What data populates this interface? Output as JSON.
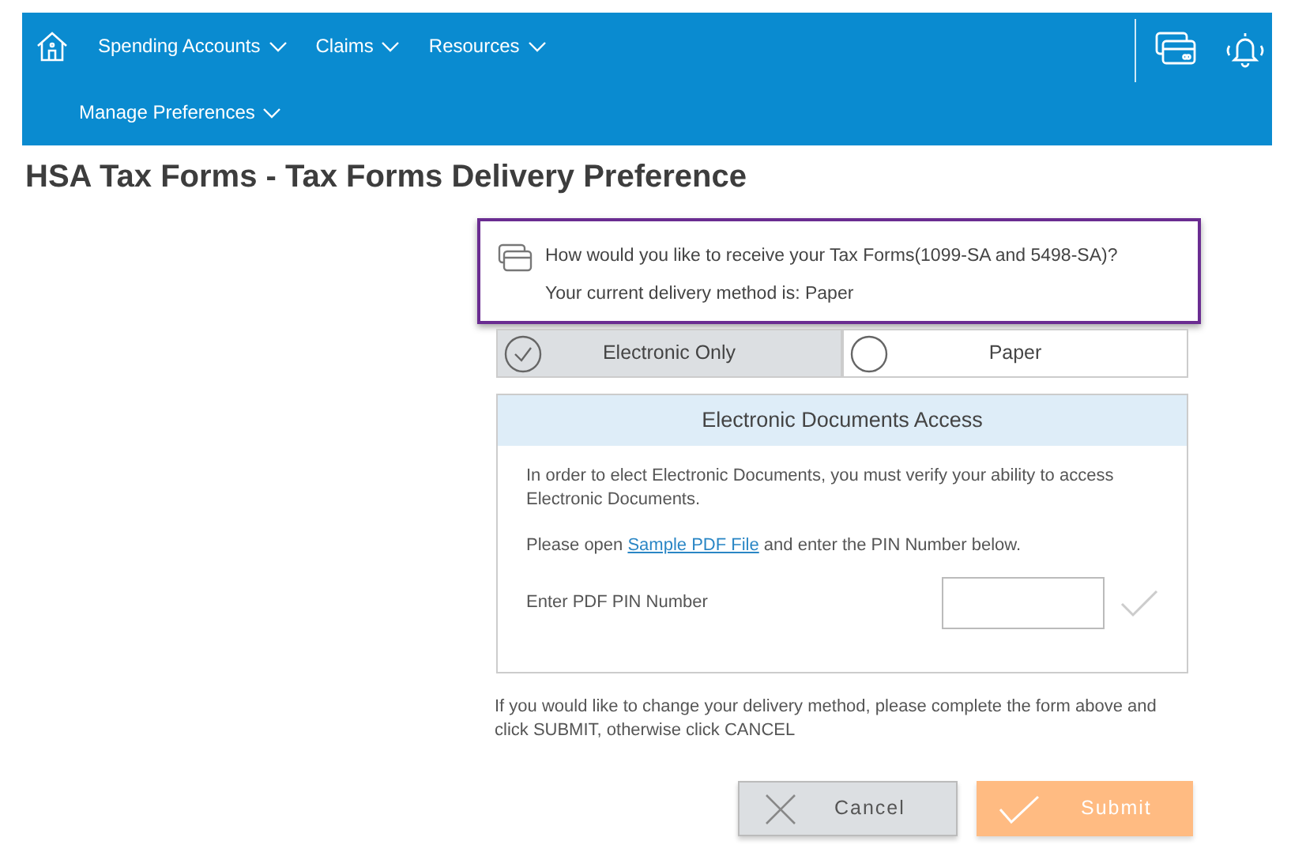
{
  "nav": {
    "items": [
      {
        "label": "Spending Accounts"
      },
      {
        "label": "Claims"
      },
      {
        "label": "Resources"
      }
    ],
    "second_row_items": [
      {
        "label": "Manage Preferences"
      }
    ]
  },
  "title": "HSA Tax Forms - Tax Forms Delivery Preference",
  "prompt": {
    "question": "How would you like to receive your Tax Forms(1099-SA and 5498-SA)?",
    "current": "Your current delivery method is: Paper"
  },
  "options": [
    {
      "label": "Electronic Only",
      "selected": true
    },
    {
      "label": "Paper",
      "selected": false
    }
  ],
  "panel": {
    "header": "Electronic Documents Access",
    "intro": "In order to elect Electronic Documents, you must verify your ability to access Electronic Documents.",
    "open_before": "Please open ",
    "open_link": "Sample PDF File",
    "open_after": " and enter the PIN Number below.",
    "pin_label": "Enter PDF PIN Number"
  },
  "note": "If you would like to change your delivery method, please complete the form above and click SUBMIT, otherwise click CANCEL",
  "buttons": [
    {
      "label": "Cancel",
      "kind": "cancel"
    },
    {
      "label": "Submit",
      "kind": "submit"
    }
  ]
}
